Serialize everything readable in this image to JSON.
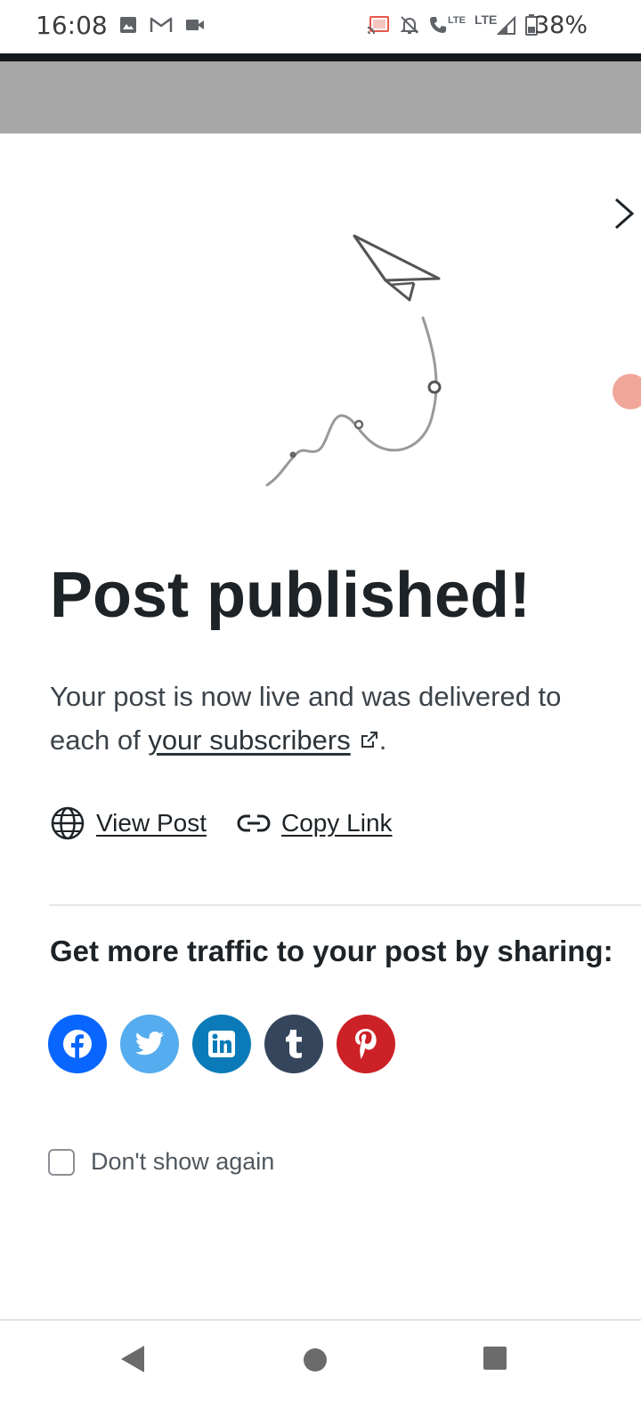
{
  "status_bar": {
    "time": "16:08",
    "battery_percent": "38%",
    "left_icons": [
      "image-icon",
      "gmail-icon",
      "video-camera-icon"
    ],
    "right_icons": [
      "cast-icon",
      "notifications-off-icon",
      "volte-call-icon",
      "lte-signal-icon",
      "battery-icon"
    ],
    "lte_label_1": "LTE",
    "lte_label_2": "LTE"
  },
  "modal": {
    "title": "Post published!",
    "description_prefix": "Your post is now live and was delivered to each of ",
    "subscribers_link": "your subscribers",
    "description_suffix": ".",
    "actions": {
      "view_post": "View Post",
      "copy_link": "Copy Link"
    },
    "share_heading": "Get more traffic to your post by sharing:",
    "share_buttons": [
      {
        "network": "facebook",
        "icon": "facebook-icon",
        "color": "#0866ff"
      },
      {
        "network": "twitter",
        "icon": "twitter-icon",
        "color": "#55acee"
      },
      {
        "network": "linkedin",
        "icon": "linkedin-icon",
        "color": "#0a7bb8"
      },
      {
        "network": "tumblr",
        "icon": "tumblr-icon",
        "color": "#35465c"
      },
      {
        "network": "pinterest",
        "icon": "pinterest-icon",
        "color": "#cc2127"
      }
    ],
    "dont_show_again": "Don't show again",
    "dont_show_again_checked": false
  },
  "colors": {
    "header_gray": "#a7a7a7",
    "dark_strip": "#141a1f",
    "text_primary": "#1d2327",
    "side_accent": "#f0a79a"
  },
  "nav_bar": {
    "icons": [
      "back-icon",
      "home-icon",
      "recent-apps-icon"
    ]
  }
}
